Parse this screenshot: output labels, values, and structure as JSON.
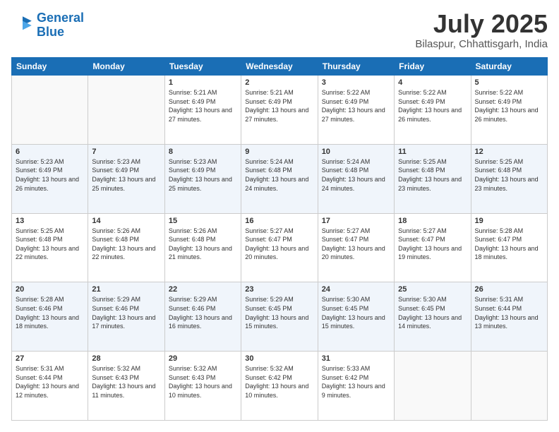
{
  "header": {
    "logo_line1": "General",
    "logo_line2": "Blue",
    "month": "July 2025",
    "location": "Bilaspur, Chhattisgarh, India"
  },
  "days_of_week": [
    "Sunday",
    "Monday",
    "Tuesday",
    "Wednesday",
    "Thursday",
    "Friday",
    "Saturday"
  ],
  "weeks": [
    [
      {
        "day": "",
        "info": ""
      },
      {
        "day": "",
        "info": ""
      },
      {
        "day": "1",
        "info": "Sunrise: 5:21 AM\nSunset: 6:49 PM\nDaylight: 13 hours and 27 minutes."
      },
      {
        "day": "2",
        "info": "Sunrise: 5:21 AM\nSunset: 6:49 PM\nDaylight: 13 hours and 27 minutes."
      },
      {
        "day": "3",
        "info": "Sunrise: 5:22 AM\nSunset: 6:49 PM\nDaylight: 13 hours and 27 minutes."
      },
      {
        "day": "4",
        "info": "Sunrise: 5:22 AM\nSunset: 6:49 PM\nDaylight: 13 hours and 26 minutes."
      },
      {
        "day": "5",
        "info": "Sunrise: 5:22 AM\nSunset: 6:49 PM\nDaylight: 13 hours and 26 minutes."
      }
    ],
    [
      {
        "day": "6",
        "info": "Sunrise: 5:23 AM\nSunset: 6:49 PM\nDaylight: 13 hours and 26 minutes."
      },
      {
        "day": "7",
        "info": "Sunrise: 5:23 AM\nSunset: 6:49 PM\nDaylight: 13 hours and 25 minutes."
      },
      {
        "day": "8",
        "info": "Sunrise: 5:23 AM\nSunset: 6:49 PM\nDaylight: 13 hours and 25 minutes."
      },
      {
        "day": "9",
        "info": "Sunrise: 5:24 AM\nSunset: 6:48 PM\nDaylight: 13 hours and 24 minutes."
      },
      {
        "day": "10",
        "info": "Sunrise: 5:24 AM\nSunset: 6:48 PM\nDaylight: 13 hours and 24 minutes."
      },
      {
        "day": "11",
        "info": "Sunrise: 5:25 AM\nSunset: 6:48 PM\nDaylight: 13 hours and 23 minutes."
      },
      {
        "day": "12",
        "info": "Sunrise: 5:25 AM\nSunset: 6:48 PM\nDaylight: 13 hours and 23 minutes."
      }
    ],
    [
      {
        "day": "13",
        "info": "Sunrise: 5:25 AM\nSunset: 6:48 PM\nDaylight: 13 hours and 22 minutes."
      },
      {
        "day": "14",
        "info": "Sunrise: 5:26 AM\nSunset: 6:48 PM\nDaylight: 13 hours and 22 minutes."
      },
      {
        "day": "15",
        "info": "Sunrise: 5:26 AM\nSunset: 6:48 PM\nDaylight: 13 hours and 21 minutes."
      },
      {
        "day": "16",
        "info": "Sunrise: 5:27 AM\nSunset: 6:47 PM\nDaylight: 13 hours and 20 minutes."
      },
      {
        "day": "17",
        "info": "Sunrise: 5:27 AM\nSunset: 6:47 PM\nDaylight: 13 hours and 20 minutes."
      },
      {
        "day": "18",
        "info": "Sunrise: 5:27 AM\nSunset: 6:47 PM\nDaylight: 13 hours and 19 minutes."
      },
      {
        "day": "19",
        "info": "Sunrise: 5:28 AM\nSunset: 6:47 PM\nDaylight: 13 hours and 18 minutes."
      }
    ],
    [
      {
        "day": "20",
        "info": "Sunrise: 5:28 AM\nSunset: 6:46 PM\nDaylight: 13 hours and 18 minutes."
      },
      {
        "day": "21",
        "info": "Sunrise: 5:29 AM\nSunset: 6:46 PM\nDaylight: 13 hours and 17 minutes."
      },
      {
        "day": "22",
        "info": "Sunrise: 5:29 AM\nSunset: 6:46 PM\nDaylight: 13 hours and 16 minutes."
      },
      {
        "day": "23",
        "info": "Sunrise: 5:29 AM\nSunset: 6:45 PM\nDaylight: 13 hours and 15 minutes."
      },
      {
        "day": "24",
        "info": "Sunrise: 5:30 AM\nSunset: 6:45 PM\nDaylight: 13 hours and 15 minutes."
      },
      {
        "day": "25",
        "info": "Sunrise: 5:30 AM\nSunset: 6:45 PM\nDaylight: 13 hours and 14 minutes."
      },
      {
        "day": "26",
        "info": "Sunrise: 5:31 AM\nSunset: 6:44 PM\nDaylight: 13 hours and 13 minutes."
      }
    ],
    [
      {
        "day": "27",
        "info": "Sunrise: 5:31 AM\nSunset: 6:44 PM\nDaylight: 13 hours and 12 minutes."
      },
      {
        "day": "28",
        "info": "Sunrise: 5:32 AM\nSunset: 6:43 PM\nDaylight: 13 hours and 11 minutes."
      },
      {
        "day": "29",
        "info": "Sunrise: 5:32 AM\nSunset: 6:43 PM\nDaylight: 13 hours and 10 minutes."
      },
      {
        "day": "30",
        "info": "Sunrise: 5:32 AM\nSunset: 6:42 PM\nDaylight: 13 hours and 10 minutes."
      },
      {
        "day": "31",
        "info": "Sunrise: 5:33 AM\nSunset: 6:42 PM\nDaylight: 13 hours and 9 minutes."
      },
      {
        "day": "",
        "info": ""
      },
      {
        "day": "",
        "info": ""
      }
    ]
  ]
}
